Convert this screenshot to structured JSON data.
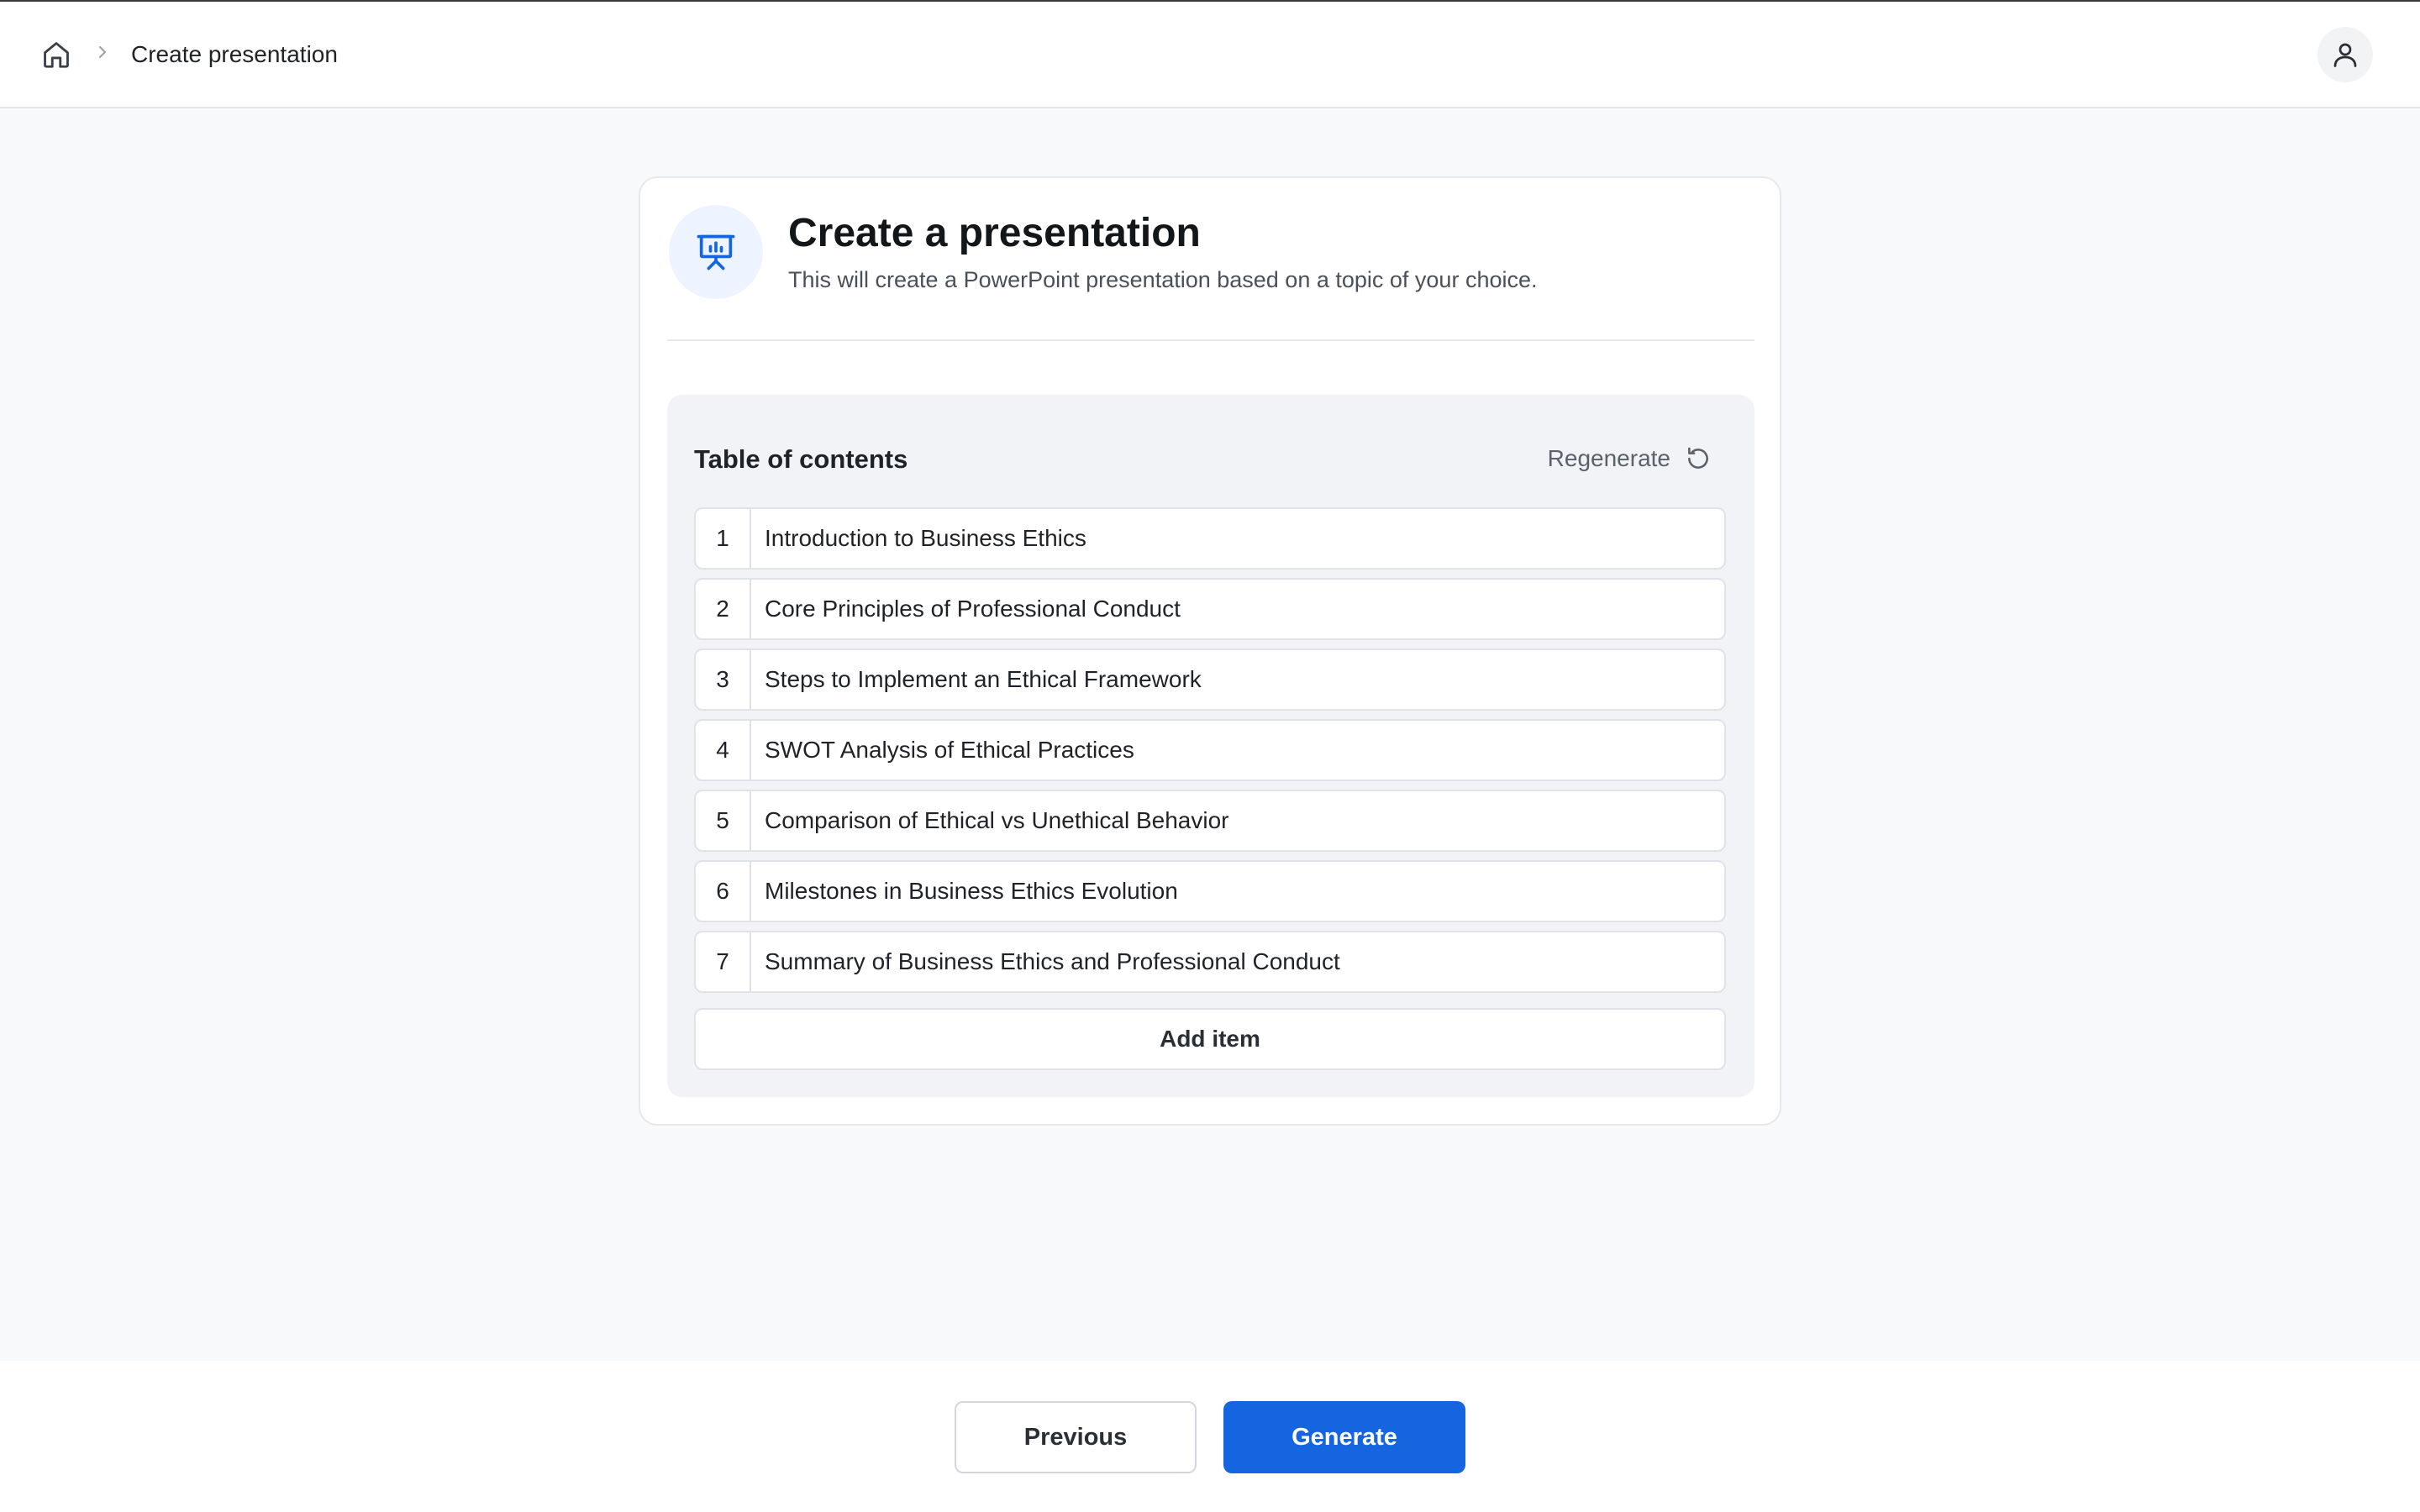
{
  "breadcrumb": {
    "home_icon": "home-icon",
    "separator_icon": "chevron-right-icon",
    "current": "Create presentation"
  },
  "header": {
    "user_icon": "user-icon"
  },
  "card": {
    "icon": "presentation-icon",
    "title": "Create a presentation",
    "subtitle": "This will create a PowerPoint presentation based on a topic of your choice."
  },
  "toc": {
    "title": "Table of contents",
    "regenerate_label": "Regenerate",
    "regenerate_icon": "refresh-icon",
    "items": [
      {
        "number": "1",
        "text": "Introduction to Business Ethics"
      },
      {
        "number": "2",
        "text": "Core Principles of Professional Conduct"
      },
      {
        "number": "3",
        "text": "Steps to Implement an Ethical Framework"
      },
      {
        "number": "4",
        "text": "SWOT Analysis of Ethical Practices"
      },
      {
        "number": "5",
        "text": "Comparison of Ethical vs Unethical Behavior"
      },
      {
        "number": "6",
        "text": "Milestones in Business Ethics Evolution"
      },
      {
        "number": "7",
        "text": "Summary of Business Ethics and Professional Conduct"
      }
    ],
    "add_item_label": "Add item"
  },
  "footer": {
    "previous_label": "Previous",
    "generate_label": "Generate"
  },
  "colors": {
    "accent": "#1565e0",
    "icon_bg": "#eef4ff",
    "page_bg": "#f8f9fb",
    "toc_bg": "#f2f3f6"
  }
}
